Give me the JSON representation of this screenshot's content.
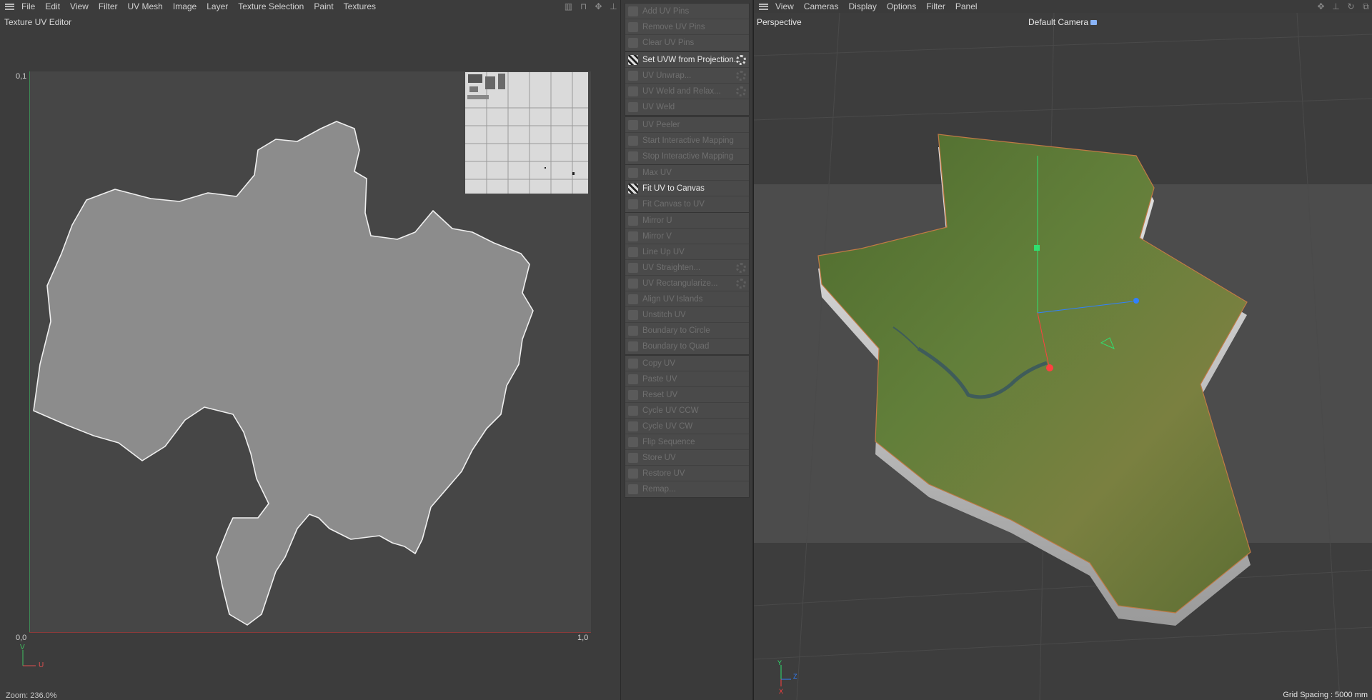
{
  "uv_editor": {
    "menu": [
      "File",
      "Edit",
      "View",
      "Filter",
      "UV Mesh",
      "Image",
      "Layer",
      "Texture Selection",
      "Paint",
      "Textures"
    ],
    "title": "Texture UV Editor",
    "label_top_left": "0,1",
    "label_bottom_left": "0,0",
    "label_bottom_right": "1,0",
    "axis_v": "V",
    "axis_u": "U",
    "zoom": "Zoom: 236.0%"
  },
  "palette": {
    "groups": [
      [
        {
          "label": "Add UV Pins",
          "active": false
        },
        {
          "label": "Remove UV Pins",
          "active": false
        },
        {
          "label": "Clear UV Pins",
          "active": false
        }
      ],
      [
        {
          "label": "Set UVW from Projection...",
          "active": true,
          "gear": true
        },
        {
          "label": "UV Unwrap...",
          "active": false,
          "gear": true
        },
        {
          "label": "UV Weld and Relax...",
          "active": false,
          "gear": true
        },
        {
          "label": "UV Weld",
          "active": false
        }
      ],
      [
        {
          "label": "UV Peeler",
          "active": false
        },
        {
          "label": "Start Interactive Mapping",
          "active": false
        },
        {
          "label": "Stop Interactive Mapping",
          "active": false
        }
      ],
      [
        {
          "label": "Max UV",
          "active": false
        },
        {
          "label": "Fit UV to Canvas",
          "active": true
        },
        {
          "label": "Fit Canvas to UV",
          "active": false
        }
      ],
      [
        {
          "label": "Mirror U",
          "active": false
        },
        {
          "label": "Mirror V",
          "active": false
        },
        {
          "label": "Line Up UV",
          "active": false
        },
        {
          "label": "UV Straighten...",
          "active": false,
          "gear": true
        },
        {
          "label": "UV Rectangularize...",
          "active": false,
          "gear": true
        },
        {
          "label": "Align UV Islands",
          "active": false
        },
        {
          "label": "Unstitch UV",
          "active": false
        },
        {
          "label": "Boundary to Circle",
          "active": false
        },
        {
          "label": "Boundary to Quad",
          "active": false
        }
      ],
      [
        {
          "label": "Copy UV",
          "active": false
        },
        {
          "label": "Paste UV",
          "active": false
        },
        {
          "label": "Reset UV",
          "active": false
        },
        {
          "label": "Cycle UV CCW",
          "active": false
        },
        {
          "label": "Cycle UV CW",
          "active": false
        },
        {
          "label": "Flip Sequence",
          "active": false
        },
        {
          "label": "Store UV",
          "active": false
        },
        {
          "label": "Restore UV",
          "active": false
        },
        {
          "label": "Remap...",
          "active": false
        }
      ]
    ]
  },
  "viewport": {
    "menu": [
      "View",
      "Cameras",
      "Display",
      "Options",
      "Filter",
      "Panel"
    ],
    "view_name": "Perspective",
    "camera": "Default Camera",
    "grid_spacing": "Grid Spacing : 5000 mm",
    "axis_x": "X",
    "axis_y": "Y",
    "axis_z": "Z"
  },
  "colors": {
    "axis_u": "#e05050",
    "axis_v": "#40c060",
    "gizmo_x": "#ff4040",
    "gizmo_y": "#30e070",
    "gizmo_z": "#3080ff",
    "terrain": "#5a7a3a"
  }
}
